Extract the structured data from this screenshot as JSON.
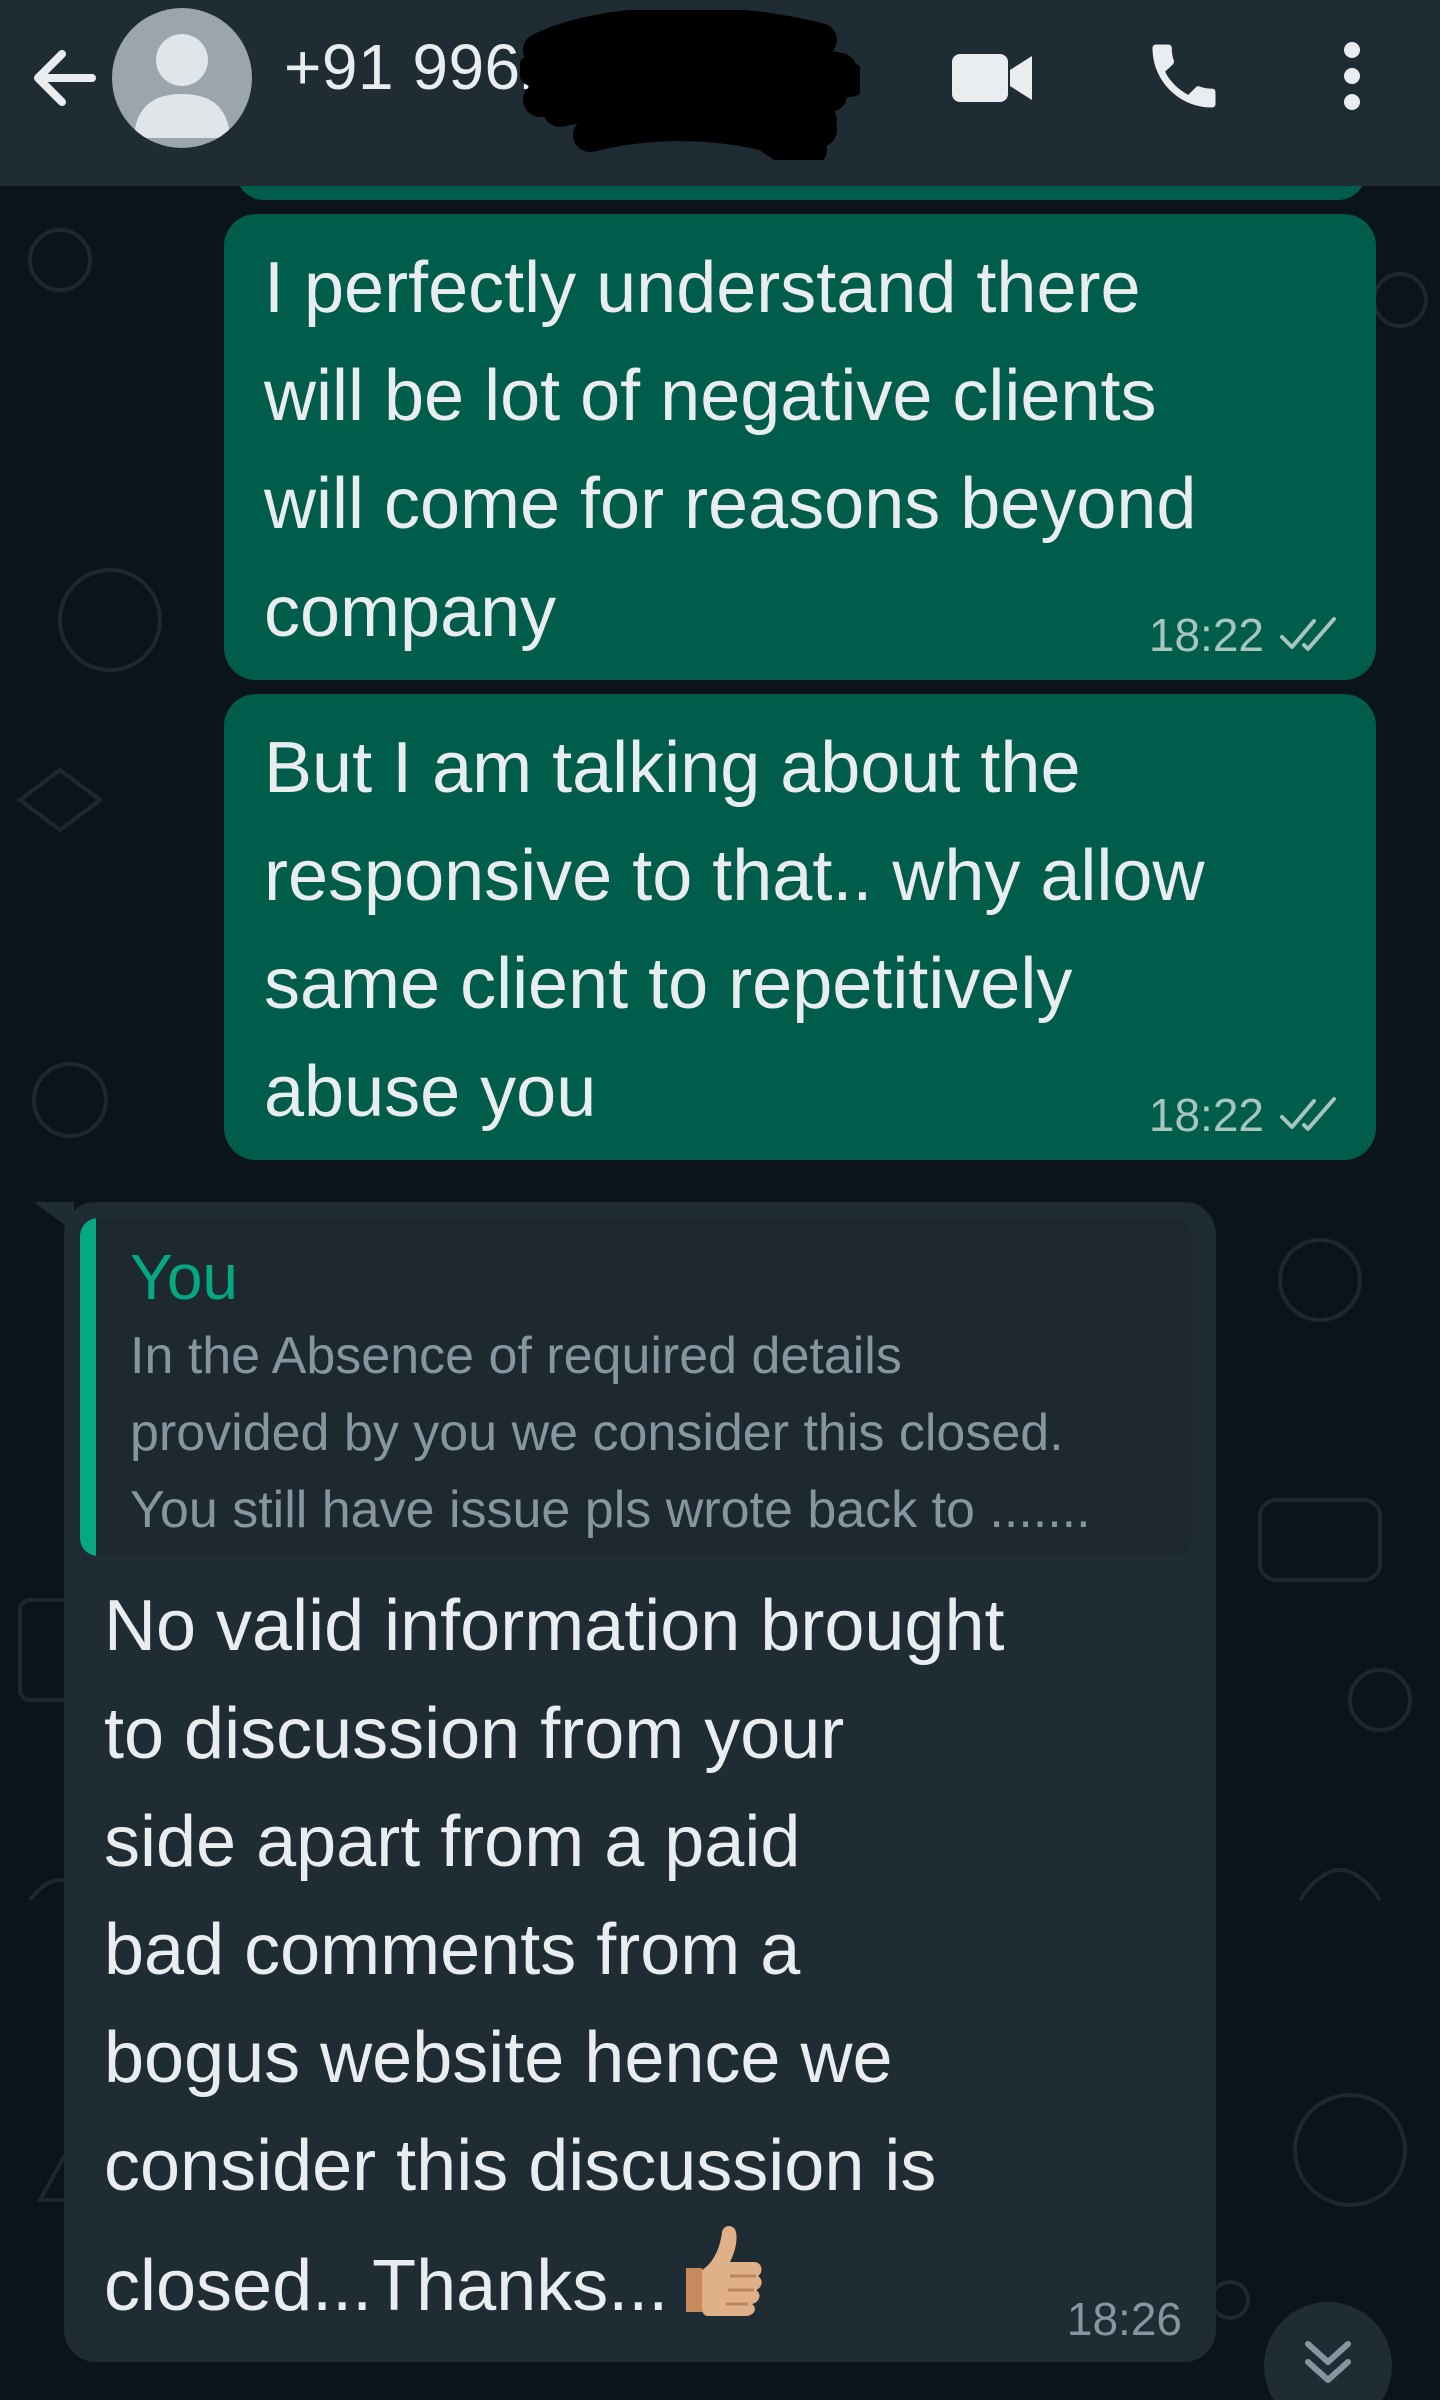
{
  "header": {
    "contact_name": "+91 99621",
    "icons": {
      "back": "arrow-left-icon",
      "video": "video-camera-icon",
      "call": "phone-icon",
      "menu": "kebab-menu-icon"
    }
  },
  "messages": [
    {
      "direction": "outgoing",
      "text": "I perfectly understand there\nwill be lot of negative clients\nwill come for reasons beyond\ncompany",
      "time": "18:22",
      "status": "delivered"
    },
    {
      "direction": "outgoing",
      "text": "But I am talking about the\nresponsive to that..  why allow\nsame client to repetitively\nabuse you",
      "time": "18:22",
      "status": "delivered"
    },
    {
      "direction": "incoming",
      "quote": {
        "author": "You",
        "text": "In the Absence of required details\nprovided by you we consider this closed.\nYou still have issue pls wrote back to ......."
      },
      "text": "No valid information brought\nto discussion from your\nside apart from a paid\nbad comments from a\nbogus website hence we\nconsider this discussion is\nclosed...Thanks...",
      "emoji": "thumbs-up",
      "time": "18:26"
    }
  ],
  "colors": {
    "header_bg": "#1f2c34",
    "chat_bg": "#0b141a",
    "outgoing_bubble": "#005c4b",
    "incoming_bubble": "#202c33",
    "quote_accent": "#06a884",
    "text_primary": "#e9edef",
    "text_secondary": "#8696a0"
  }
}
